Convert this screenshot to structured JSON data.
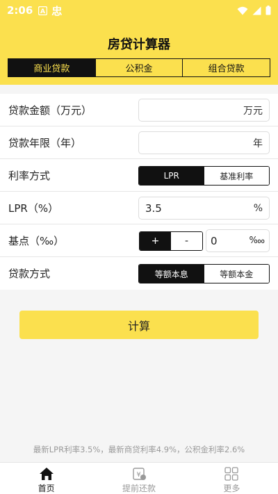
{
  "status": {
    "time": "2:06",
    "app_glyph": "忠"
  },
  "header": {
    "title": "房贷计算器"
  },
  "tabs": [
    {
      "label": "商业贷款",
      "active": true
    },
    {
      "label": "公积金",
      "active": false
    },
    {
      "label": "组合贷款",
      "active": false
    }
  ],
  "form": {
    "amount": {
      "label": "贷款金额（万元）",
      "value": "",
      "unit": "万元"
    },
    "years": {
      "label": "贷款年限（年）",
      "value": "",
      "unit": "年"
    },
    "rate_mode": {
      "label": "利率方式",
      "options": [
        "LPR",
        "基准利率"
      ],
      "selected": "LPR"
    },
    "lpr": {
      "label": "LPR（%）",
      "value": "3.5",
      "unit": "%"
    },
    "basis_point": {
      "label": "基点（‰）",
      "plus": "+",
      "minus": "-",
      "value": "0",
      "unit": "‱"
    },
    "repay_mode": {
      "label": "贷款方式",
      "options": [
        "等额本息",
        "等额本金"
      ],
      "selected": "等额本息"
    }
  },
  "actions": {
    "calculate": "计算"
  },
  "footer_note": "最新LPR利率3.5%，最新商贷利率4.9%，公积金利率2.6%",
  "nav": [
    {
      "label": "首页",
      "icon": "home-icon",
      "active": true
    },
    {
      "label": "提前还款",
      "icon": "yuan-calendar-icon",
      "active": false
    },
    {
      "label": "更多",
      "icon": "grid-icon",
      "active": false
    }
  ],
  "colors": {
    "accent": "#fbe04e",
    "dark": "#111111"
  }
}
